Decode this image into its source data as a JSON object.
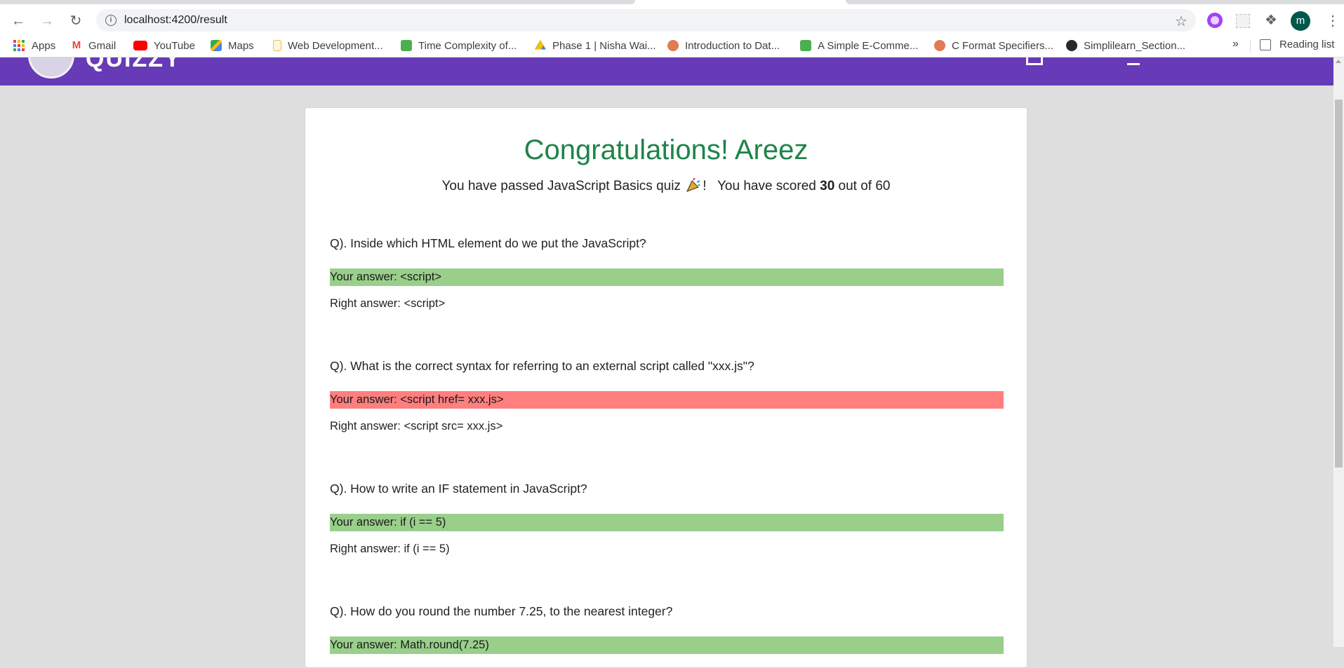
{
  "browser": {
    "url": "localhost:4200/result",
    "profile_initial": "m",
    "bookmarks": [
      {
        "label": "Apps",
        "icon": "apps-grid-icon"
      },
      {
        "label": "Gmail",
        "icon": "gmail-icon",
        "color": "#ea4335"
      },
      {
        "label": "YouTube",
        "icon": "youtube-icon",
        "color": "#ff0000"
      },
      {
        "label": "Maps",
        "icon": "maps-icon",
        "color": "#34a853"
      },
      {
        "label": "Web Development...",
        "icon": "web-dev-icon",
        "color": "#f4b400"
      },
      {
        "label": "Time Complexity of...",
        "icon": "leaf-icon",
        "color": "#4caf50"
      },
      {
        "label": "Phase 1 | Nisha Wai...",
        "icon": "drive-icon",
        "color": "#fbbc04"
      },
      {
        "label": "Introduction to Dat...",
        "icon": "avatar-icon",
        "color": "#e07b53"
      },
      {
        "label": "A Simple E-Comme...",
        "icon": "leaf-icon",
        "color": "#4caf50"
      },
      {
        "label": "C Format Specifiers...",
        "icon": "avatar-icon",
        "color": "#e07b53"
      },
      {
        "label": "Simplilearn_Section...",
        "icon": "github-icon",
        "color": "#24292e"
      }
    ],
    "more_label": "»",
    "reading_list_label": "Reading list"
  },
  "app": {
    "brand_color": "#673ab7"
  },
  "result": {
    "title": "Congratulations! Areez",
    "summary_prefix": "You have passed JavaScript Basics quiz",
    "summary_mid": "!   You have scored",
    "score": "30",
    "summary_suffix": "out of 60"
  },
  "questions": [
    {
      "question": "Q). Inside which HTML element do we put the JavaScript?",
      "your_answer": "Your answer: <script>",
      "right_answer": "Right answer: <script>",
      "status": "correct"
    },
    {
      "question": "Q). What is the correct syntax for referring to an external script called \"xxx.js\"?",
      "your_answer": "Your answer: <script href= xxx.js>",
      "right_answer": "Right answer: <script src= xxx.js>",
      "status": "wrong"
    },
    {
      "question": "Q). How to write an IF statement in JavaScript?",
      "your_answer": "Your answer: if (i == 5)",
      "right_answer": "Right answer: if (i == 5)",
      "status": "correct"
    },
    {
      "question": "Q). How do you round the number 7.25, to the nearest integer?",
      "your_answer": "Your answer: Math.round(7.25)",
      "right_answer": "",
      "status": "correct"
    }
  ],
  "colors": {
    "correct": "#99cf8b",
    "wrong": "#ff7f7f",
    "title_green": "#1e8449"
  }
}
